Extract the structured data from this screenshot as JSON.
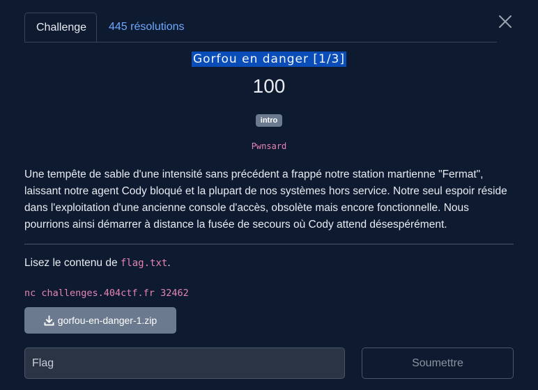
{
  "tabs": {
    "challenge_label": "Challenge",
    "solves_label": "445 résolutions"
  },
  "challenge": {
    "title": "Gorfou en danger [1/3]",
    "points": "100",
    "tag": "intro",
    "author": "Pwnsard",
    "description": "Une tempête de sable d'une intensité sans précédent a frappé notre station martienne \"Fermat\", laissant notre agent Cody bloqué et la plupart de nos systèmes hors service. Notre seul espoir réside dans l'exploitation d'une ancienne console d'accès, obsolète mais encore fonctionnelle. Nous pourrions ainsi démarrer à distance la fusée de secours où Cody attend désespérément.",
    "instruction_prefix": "Lisez le contenu de ",
    "instruction_file": "flag.txt",
    "instruction_suffix": ".",
    "command": "nc challenges.404ctf.fr 32462",
    "download_label": "gorfou-en-danger-1.zip"
  },
  "form": {
    "flag_placeholder": "Flag",
    "submit_label": "Soumettre"
  },
  "icons": {
    "close": "close-icon",
    "download": "download-icon"
  }
}
